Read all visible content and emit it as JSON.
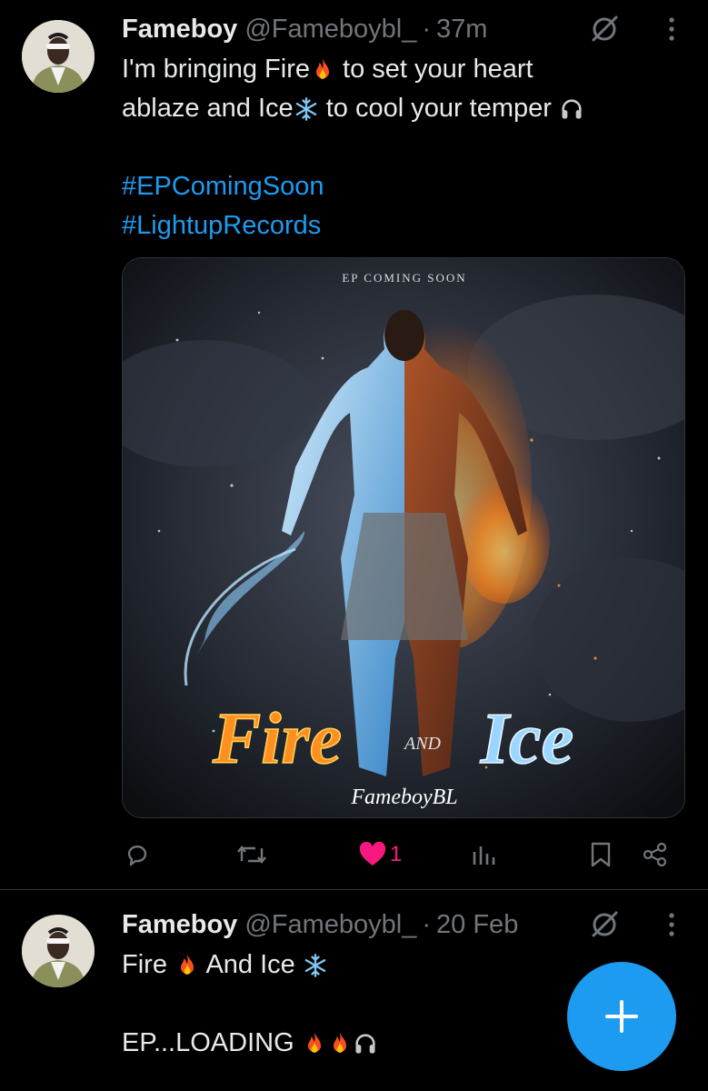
{
  "tweet1": {
    "name": "Fameboy",
    "handle": "@Fameboybl_",
    "separator": "·",
    "time": "37m",
    "line1_a": "I'm bringing Fire",
    "line1_b": " to set your heart",
    "line2_a": "ablaze and Ice",
    "line2_b": " to cool your temper ",
    "hashtag1": "#EPComingSoon",
    "hashtag2": "#LightupRecords",
    "media": {
      "top_text": "EP COMING SOON",
      "title_fire": "Fire",
      "title_and": "AND",
      "title_ice": "Ice",
      "signature": "FameboyBL"
    },
    "like_count": "1"
  },
  "tweet2": {
    "name": "Fameboy",
    "handle": "@Fameboybl_",
    "separator": "·",
    "time": "20 Feb",
    "line1_a": "Fire ",
    "line1_b": " And Ice ",
    "line3": "EP...LOADING "
  },
  "icons": {
    "fire": "fire-icon",
    "snowflake": "snowflake-icon",
    "headphones": "headphones-icon",
    "reply": "reply-icon",
    "repost": "repost-icon",
    "like": "heart-icon",
    "views": "views-icon",
    "bookmark": "bookmark-icon",
    "share": "share-icon",
    "compose": "plus-icon"
  },
  "colors": {
    "accent": "#1d9bf0",
    "like": "#f91880",
    "muted": "#71767b",
    "text": "#e7e9ea"
  }
}
